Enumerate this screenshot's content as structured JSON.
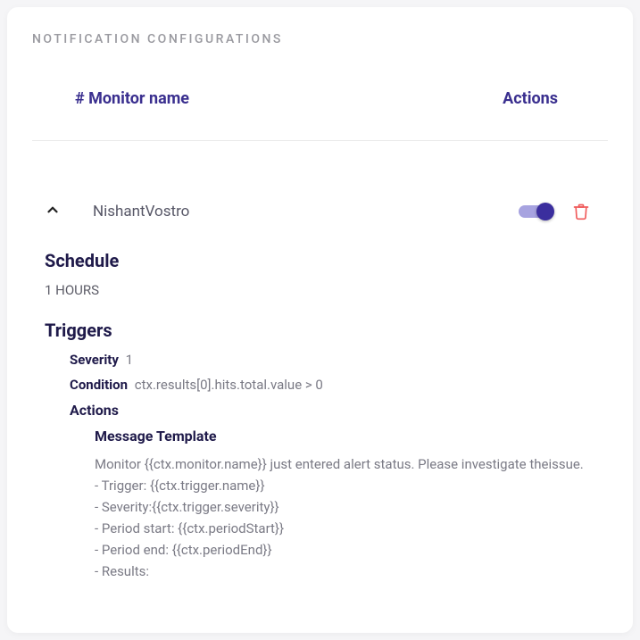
{
  "title": "NOTIFICATION CONFIGURATIONS",
  "header": {
    "name_col": "# Monitor name",
    "actions_col": "Actions"
  },
  "monitor": {
    "name": "NishantVostro",
    "enabled": true
  },
  "schedule": {
    "label": "Schedule",
    "value": "1 HOURS"
  },
  "triggers": {
    "label": "Triggers",
    "severity_label": "Severity",
    "severity_value": "1",
    "condition_label": "Condition",
    "condition_value": "ctx.results[0].hits.total.value > 0",
    "actions_label": "Actions",
    "message_template_label": "Message Template",
    "message_template_body": "Monitor {{ctx.monitor.name}} just entered alert status. Please investigate theissue.\n- Trigger: {{ctx.trigger.name}}\n- Severity:{{ctx.trigger.severity}}\n- Period start: {{ctx.periodStart}}\n- Period end: {{ctx.periodEnd}}\n- Results:"
  }
}
